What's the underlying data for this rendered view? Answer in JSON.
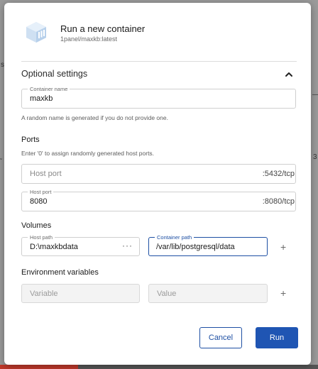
{
  "background": {
    "left_glyph_1": "s",
    "left_glyph_2": "̴",
    "right_glyph_1": "—",
    "right_glyph_2": "3"
  },
  "dialog": {
    "title": "Run a new container",
    "subtitle": "1panel/maxkb:latest",
    "icon": "docker-container-icon",
    "optional_settings": {
      "title": "Optional settings",
      "toggle_icon": "chevron-up-icon",
      "container_name": {
        "label": "Container name",
        "value": "maxkb",
        "hint": "A random name is generated if you do not provide one."
      }
    },
    "ports": {
      "title": "Ports",
      "hint": "Enter '0' to assign randomly generated host ports.",
      "rows": [
        {
          "placeholder": "Host port",
          "label": "",
          "value": "",
          "suffix": ":5432/tcp"
        },
        {
          "placeholder": "",
          "label": "Host port",
          "value": "8080",
          "suffix": ":8080/tcp"
        }
      ]
    },
    "volumes": {
      "title": "Volumes",
      "host_path": {
        "label": "Host path",
        "value": "D:\\maxkbdata",
        "more_icon": "more-dots-icon"
      },
      "container_path": {
        "label": "Container path",
        "value": "/var/lib/postgresql/data"
      },
      "add_icon": "plus-icon"
    },
    "env": {
      "title": "Environment variables",
      "variable_placeholder": "Variable",
      "value_placeholder": "Value",
      "add_icon": "plus-icon"
    },
    "buttons": {
      "cancel": "Cancel",
      "run": "Run"
    },
    "colors": {
      "primary": "#1f55b3",
      "border": "#cfcfcf",
      "disabled_bg": "#f3f3f3"
    }
  }
}
